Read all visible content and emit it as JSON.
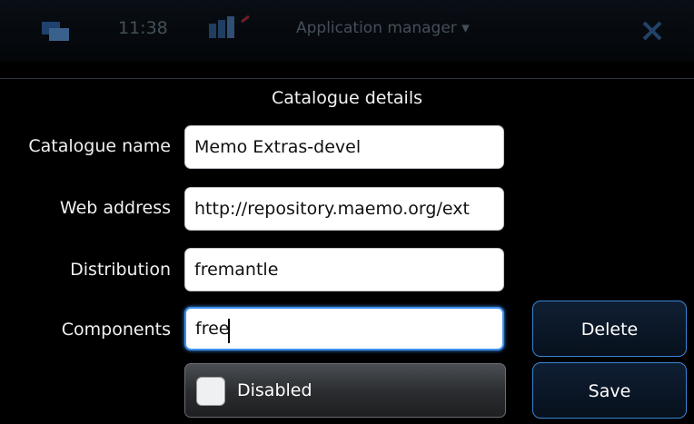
{
  "status_bar": {
    "clock": "11:38",
    "app_title": "Application manager ▾"
  },
  "dialog": {
    "title": "Catalogue details",
    "fields": [
      {
        "label": "Catalogue name",
        "value": "Memo Extras-devel"
      },
      {
        "label": "Web address",
        "value": "http://repository.maemo.org/ext"
      },
      {
        "label": "Distribution",
        "value": "fremantle"
      },
      {
        "label": "Components",
        "value": "free"
      }
    ],
    "disabled_checkbox": {
      "label": "Disabled",
      "checked": false
    },
    "buttons": {
      "delete": "Delete",
      "save": "Save"
    }
  },
  "colors": {
    "accent": "#3c8ff0",
    "background": "#000000",
    "field_background": "#ffffff"
  }
}
